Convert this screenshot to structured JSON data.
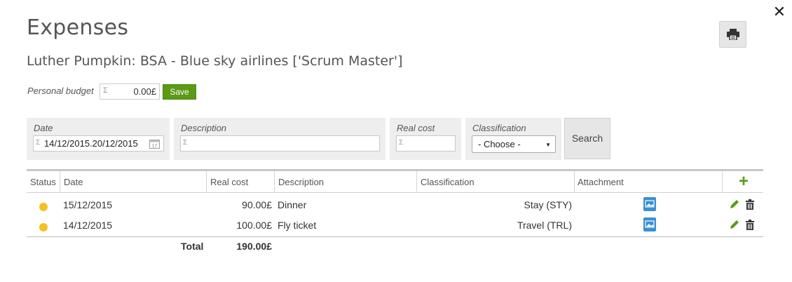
{
  "header": {
    "title": "Expenses",
    "subtitle": "Luther Pumpkin: BSA - Blue sky airlines ['Scrum Master']"
  },
  "budget": {
    "label": "Personal budget",
    "value": "0.00£",
    "save_label": "Save"
  },
  "filters": {
    "date_label": "Date",
    "date_value": "14/12/2015.20/12/2015",
    "description_label": "Description",
    "description_value": "",
    "real_cost_label": "Real cost",
    "real_cost_value": "",
    "classification_label": "Classification",
    "classification_selected": "- Choose -",
    "search_label": "Search"
  },
  "table": {
    "columns": [
      "Status",
      "Date",
      "Real cost",
      "Description",
      "Classification",
      "Attachment"
    ],
    "add_label": "+",
    "rows": [
      {
        "status_color": "#f5c022",
        "date": "15/12/2015",
        "real_cost": "90.00£",
        "description": "Dinner",
        "classification": "Stay (STY)"
      },
      {
        "status_color": "#f5c022",
        "date": "14/12/2015",
        "real_cost": "100.00£",
        "description": "Fly ticket",
        "classification": "Travel (TRL)"
      }
    ],
    "total_label": "Total",
    "total_value": "190.00£"
  },
  "icons": {
    "close": "close-icon",
    "print": "printer-icon",
    "attachment": "image-file-icon",
    "edit": "pencil-icon",
    "delete": "trash-icon",
    "calendar": "calendar-icon"
  },
  "colors": {
    "accent_green": "#5a9a16",
    "status_pending": "#f5c022",
    "attachment_blue": "#3a8fd6"
  }
}
